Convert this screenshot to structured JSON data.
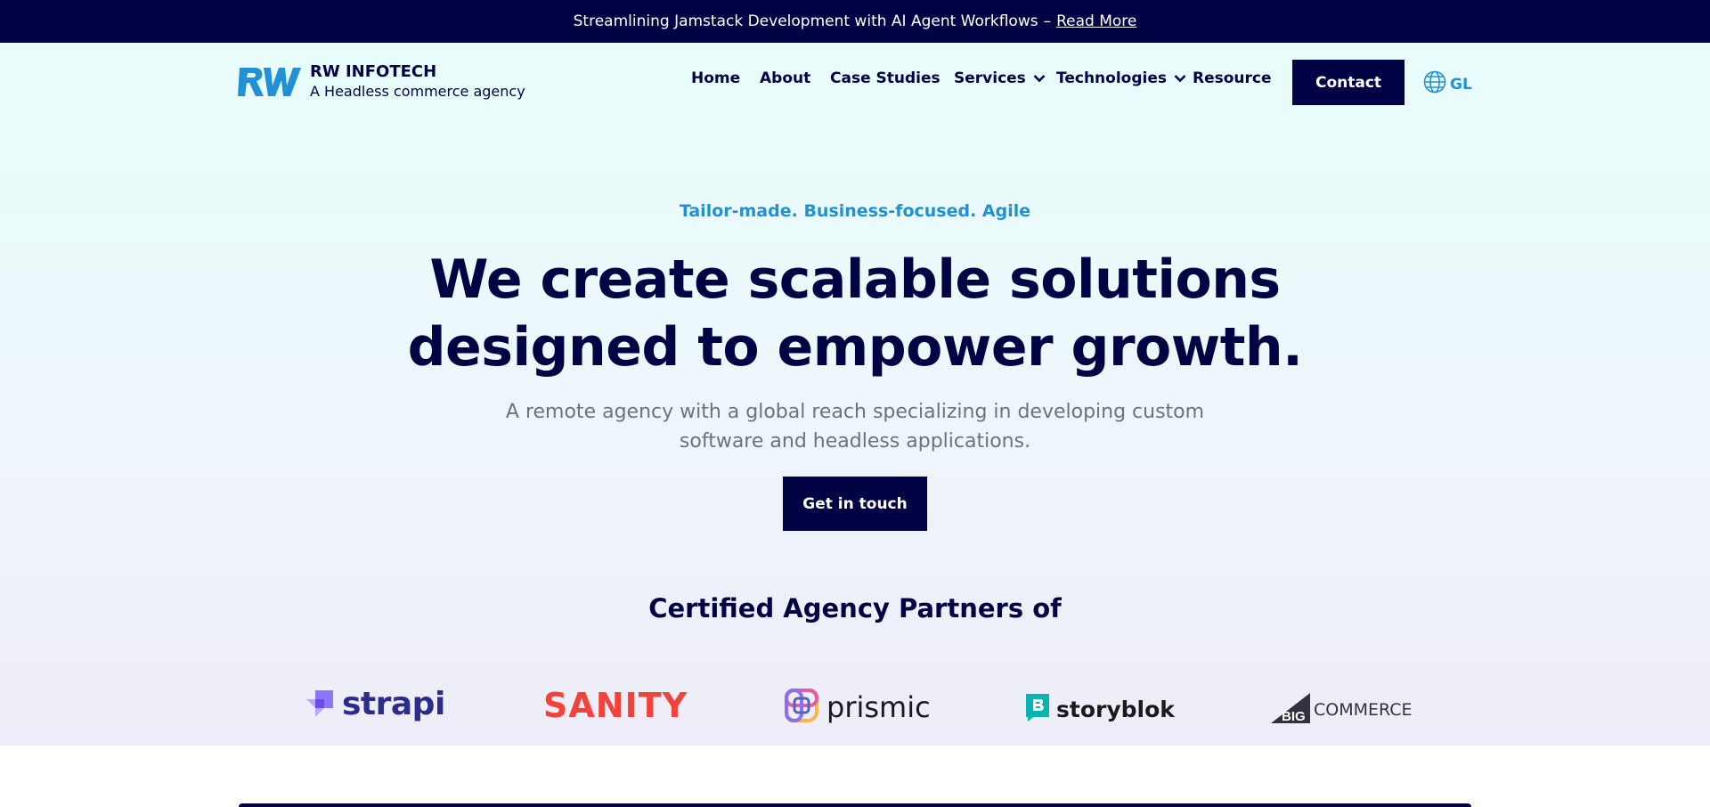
{
  "announcement": {
    "text": "Streamlining Jamstack Development with AI Agent Workflows",
    "separator": "–",
    "link_label": "Read More"
  },
  "brand": {
    "logo_icon": "rw-logo-icon",
    "name": "RW INFOTECH",
    "tagline": "A Headless commerce agency"
  },
  "nav": {
    "items": [
      {
        "label": "Home",
        "has_dropdown": false
      },
      {
        "label": "About",
        "has_dropdown": false
      },
      {
        "label": "Case Studies",
        "has_dropdown": false
      },
      {
        "label": "Services",
        "has_dropdown": true
      },
      {
        "label": "Technologies",
        "has_dropdown": true
      },
      {
        "label": "Resource",
        "has_dropdown": false
      }
    ],
    "contact_label": "Contact",
    "language_label": "GL",
    "language_icon": "globe-icon"
  },
  "hero": {
    "tagline": "Tailor-made. Business-focused. Agile",
    "headline_line1": "We create scalable solutions",
    "headline_line2": "designed to empower growth.",
    "subtext": "A remote agency with a global reach specializing in developing custom software and headless applications.",
    "cta_label": "Get in touch"
  },
  "partners": {
    "title": "Certified Agency Partners of",
    "logos": [
      {
        "name": "strapi",
        "text": "strapi"
      },
      {
        "name": "sanity",
        "text": "SANITY"
      },
      {
        "name": "prismic",
        "text": "prismic"
      },
      {
        "name": "storyblok",
        "text": "storyblok"
      },
      {
        "name": "bigcommerce",
        "text_bold": "BIG",
        "text": "COMMERCE"
      }
    ]
  },
  "colors": {
    "navy": "#020344",
    "accent_blue": "#2290d4",
    "muted_text": "#6b7280",
    "sanity_red": "#f0443a",
    "storyblok_teal": "#09b3af",
    "strapi_purple": "#8e75ff"
  }
}
